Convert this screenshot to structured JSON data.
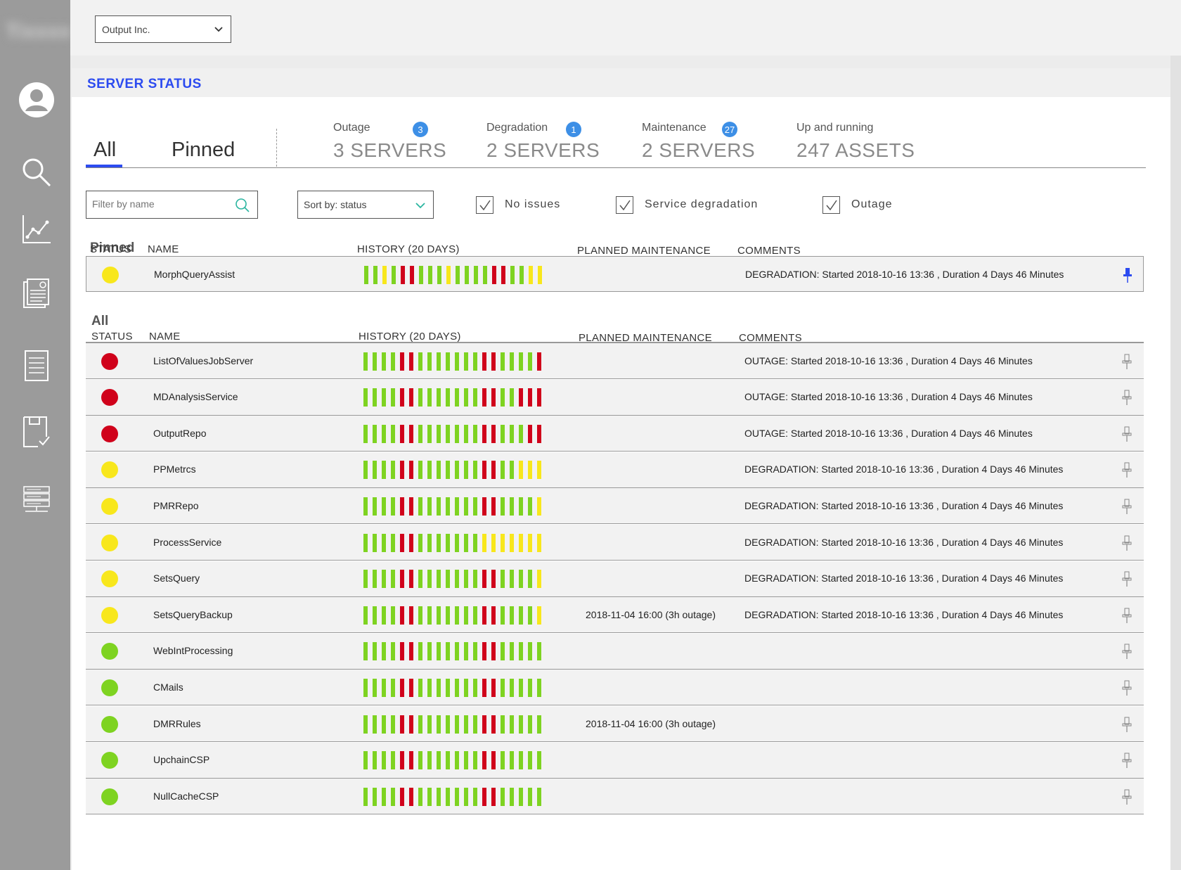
{
  "app": {
    "logo_text": "Tixxxx"
  },
  "sidebar": {
    "items": [
      {
        "name": "user-icon"
      },
      {
        "name": "search-icon"
      },
      {
        "name": "chart-icon"
      },
      {
        "name": "report-icon"
      },
      {
        "name": "list-icon"
      },
      {
        "name": "checklist-icon"
      },
      {
        "name": "server-icon"
      }
    ]
  },
  "topbar": {
    "company_selected": "Output Inc."
  },
  "panel": {
    "title": "SERVER STATUS"
  },
  "tabs": {
    "all": "All",
    "pinned": "Pinned"
  },
  "summary": [
    {
      "label": "Outage",
      "badge": "3",
      "value": "3 SERVERS"
    },
    {
      "label": "Degradation",
      "badge": "1",
      "value": "2 SERVERS"
    },
    {
      "label": "Maintenance",
      "badge": "27",
      "value": "2 SERVERS"
    },
    {
      "label": "Up and running",
      "badge": null,
      "value": "247 ASSETS"
    }
  ],
  "filters": {
    "name_placeholder": "Filter by name",
    "sort_label": "Sort by: status",
    "checkboxes": [
      {
        "label": "No issues",
        "checked": true
      },
      {
        "label": "Service degradation",
        "checked": true
      },
      {
        "label": "Outage",
        "checked": true
      }
    ]
  },
  "columns": {
    "status": "STATUS",
    "name": "NAME",
    "history": "HISTORY (20 DAYS)",
    "maintenance": "PLANNED MAINTENANCE",
    "comments": "COMMENTS"
  },
  "colors": {
    "green": "#7ed321",
    "yellow": "#f8e71c",
    "red": "#d0021b",
    "accent": "#2c4bf0",
    "badge": "#3d8fe6"
  },
  "pinned_section": {
    "title": "Pinned",
    "rows": [
      {
        "status": "yellow",
        "name": "MorphQueryAssist",
        "history": "GGYGRRGGGYGGGGRRGGYY",
        "maintenance": "",
        "comment": "DEGRADATION: Started 2018-10-16 13:36 , Duration 4 Days 46 Minutes",
        "pinned": true
      }
    ]
  },
  "all_section": {
    "title": "All",
    "rows": [
      {
        "status": "red",
        "name": "ListOfValuesJobServer",
        "history": "GGGGRRGGGGGGGRRGGGGR",
        "maintenance": "",
        "comment": "OUTAGE: Started 2018-10-16 13:36 , Duration 4 Days 46 Minutes",
        "pinned": false
      },
      {
        "status": "red",
        "name": "MDAnalysisService",
        "history": "GGGGRRGGGGGGGRRGGRRR",
        "maintenance": "",
        "comment": "OUTAGE: Started 2018-10-16 13:36 , Duration 4 Days 46 Minutes",
        "pinned": false
      },
      {
        "status": "red",
        "name": "OutputRepo",
        "history": "GGGGRRGGGGGGGRRGGGRR",
        "maintenance": "",
        "comment": "OUTAGE: Started 2018-10-16 13:36 , Duration 4 Days 46 Minutes",
        "pinned": false
      },
      {
        "status": "yellow",
        "name": "PPMetrcs",
        "history": "GGGGRRGGGGGGGRRGGYYY",
        "maintenance": "",
        "comment": "DEGRADATION: Started 2018-10-16 13:36 , Duration 4 Days 46 Minutes",
        "pinned": false
      },
      {
        "status": "yellow",
        "name": "PMRRepo",
        "history": "GGGGRRGGGGGGGRRGGGGY",
        "maintenance": "",
        "comment": "DEGRADATION: Started 2018-10-16 13:36 , Duration 4 Days 46 Minutes",
        "pinned": false
      },
      {
        "status": "yellow",
        "name": "ProcessService",
        "history": "GGGGRRGGGGGGGYYYYYYY",
        "maintenance": "",
        "comment": "DEGRADATION: Started 2018-10-16 13:36 , Duration 4 Days 46 Minutes",
        "pinned": false
      },
      {
        "status": "yellow",
        "name": "SetsQuery",
        "history": "GGGGRRGGGGGGGRRGGGGY",
        "maintenance": "",
        "comment": "DEGRADATION: Started 2018-10-16 13:36 , Duration 4 Days 46 Minutes",
        "pinned": false
      },
      {
        "status": "yellow",
        "name": "SetsQueryBackup",
        "history": "GGGGRRGGGGGGGRRGGGGY",
        "maintenance": "2018-11-04 16:00 (3h outage)",
        "comment": "DEGRADATION: Started 2018-10-16 13:36 , Duration 4 Days 46 Minutes",
        "pinned": false
      },
      {
        "status": "green",
        "name": "WebIntProcessing",
        "history": "GGGGRRGGGGGGGRRGGGGG",
        "maintenance": "",
        "comment": "",
        "pinned": false
      },
      {
        "status": "green",
        "name": "CMails",
        "history": "GGGGRRGGGGGGGRRGGGGG",
        "maintenance": "",
        "comment": "",
        "pinned": false
      },
      {
        "status": "green",
        "name": "DMRRules",
        "history": "GGGGRRGGGGGGGRRGGGGG",
        "maintenance": "2018-11-04 16:00 (3h outage)",
        "comment": "",
        "pinned": false
      },
      {
        "status": "green",
        "name": "UpchainCSP",
        "history": "GGGGRRGGGGGGGRRGGGGG",
        "maintenance": "",
        "comment": "",
        "pinned": false
      },
      {
        "status": "green",
        "name": "NullCacheCSP",
        "history": "GGGGRRGGGGGGGRRGGGGG",
        "maintenance": "",
        "comment": "",
        "pinned": false
      }
    ]
  }
}
